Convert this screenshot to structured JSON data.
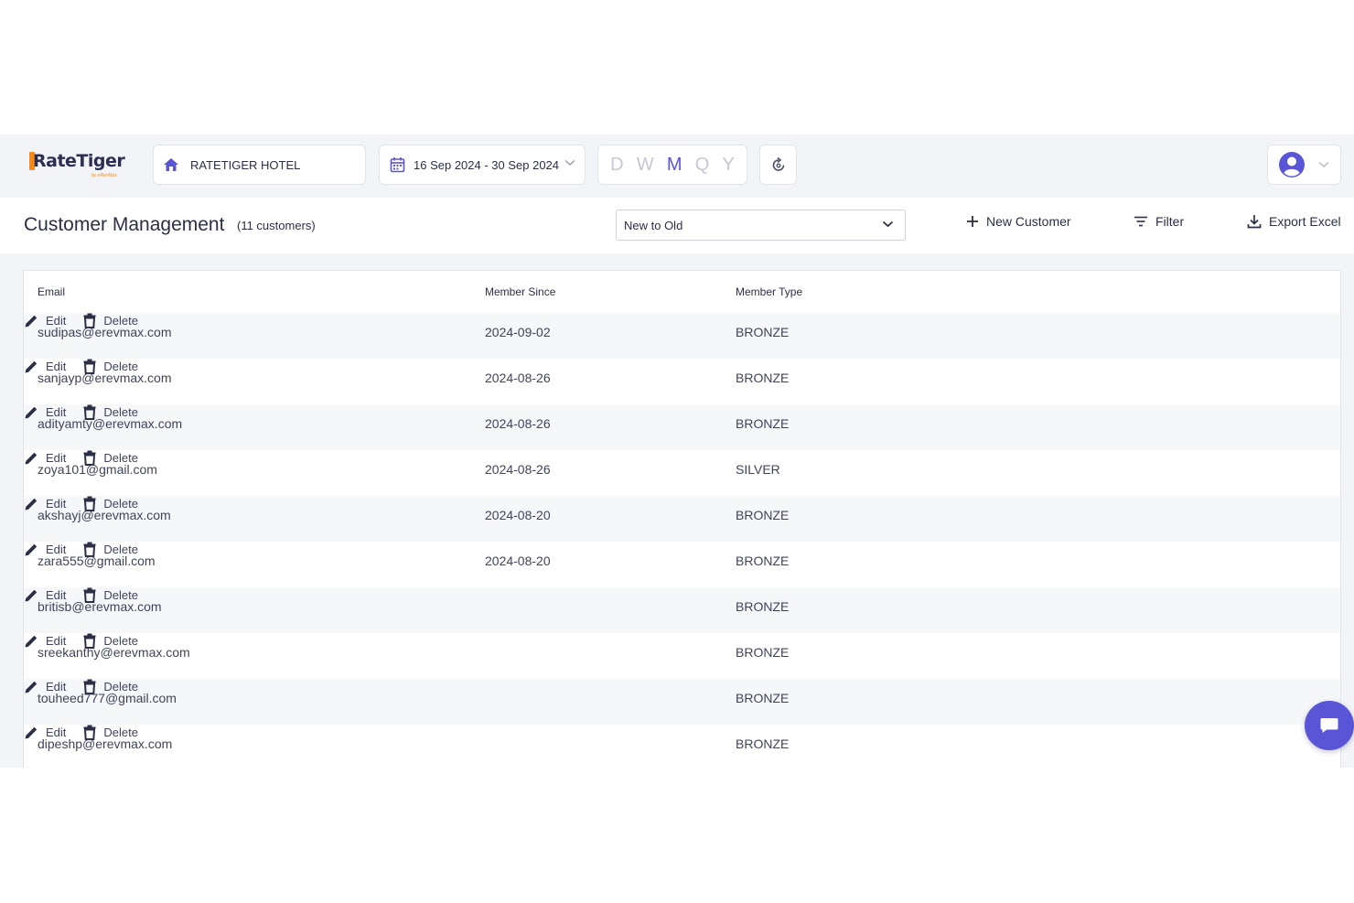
{
  "header": {
    "brand": {
      "name": "RateTiger",
      "tagline": "by eRevMax"
    },
    "hotel": {
      "icon": "home-icon",
      "name": "RATETIGER HOTEL"
    },
    "date_range": {
      "icon": "calendar-icon",
      "label": "16 Sep 2024 - 30 Sep 2024"
    },
    "periods": [
      {
        "label": "D",
        "active": false
      },
      {
        "label": "W",
        "active": false
      },
      {
        "label": "M",
        "active": true
      },
      {
        "label": "Q",
        "active": false
      },
      {
        "label": "Y",
        "active": false
      }
    ],
    "refresh_icon": "refresh-icon",
    "user_icon": "user-avatar-icon"
  },
  "page": {
    "title": "Customer Management",
    "count_label": "(11 customers)",
    "sort": {
      "selected": "New to Old"
    },
    "actions": {
      "new_customer": "New Customer",
      "filter": "Filter",
      "export": "Export Excel"
    }
  },
  "table": {
    "columns": [
      "Email",
      "Member Since",
      "Member Type"
    ],
    "edit_label": "Edit",
    "delete_label": "Delete",
    "rows": [
      {
        "email": "sudipas@erevmax.com",
        "since": "2024-09-02",
        "type": "BRONZE"
      },
      {
        "email": "sanjayp@erevmax.com",
        "since": "2024-08-26",
        "type": "BRONZE"
      },
      {
        "email": "adityamty@erevmax.com",
        "since": "2024-08-26",
        "type": "BRONZE"
      },
      {
        "email": "zoya101@gmail.com",
        "since": "2024-08-26",
        "type": "SILVER"
      },
      {
        "email": "akshayj@erevmax.com",
        "since": "2024-08-20",
        "type": "BRONZE"
      },
      {
        "email": "zara555@gmail.com",
        "since": "2024-08-20",
        "type": "BRONZE"
      },
      {
        "email": "britisb@erevmax.com",
        "since": "",
        "type": "BRONZE"
      },
      {
        "email": "sreekanthy@erevmax.com",
        "since": "",
        "type": "BRONZE"
      },
      {
        "email": "touheed777@gmail.com",
        "since": "",
        "type": "BRONZE"
      },
      {
        "email": "dipeshp@erevmax.com",
        "since": "",
        "type": "BRONZE"
      }
    ]
  },
  "colors": {
    "accent": "#5a55d6",
    "brand_orange": "#f28a1e",
    "text": "#2b2f45"
  },
  "chat_icon": "chat-icon"
}
